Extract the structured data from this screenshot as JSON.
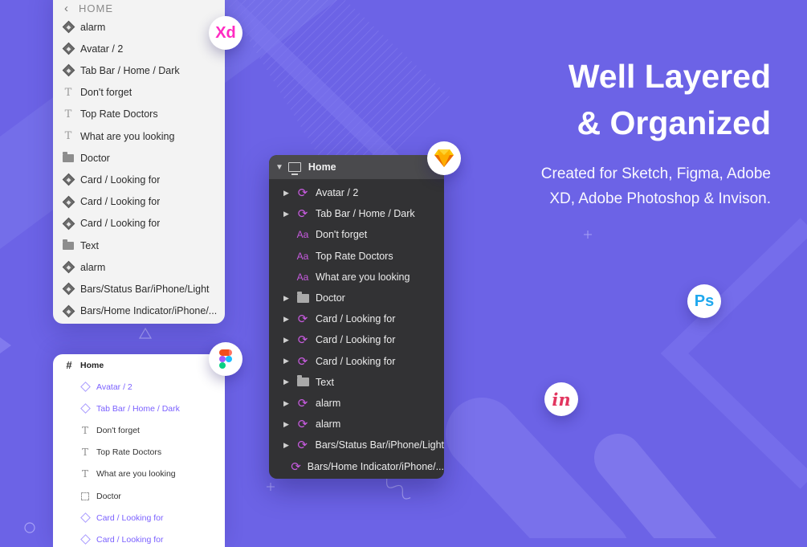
{
  "xd_panel": {
    "header": "HOME",
    "layers": [
      {
        "icon": "symbol-icon",
        "label": "alarm"
      },
      {
        "icon": "symbol-icon",
        "label": "Avatar / 2"
      },
      {
        "icon": "symbol-icon",
        "label": "Tab Bar / Home / Dark"
      },
      {
        "icon": "text-icon",
        "label": "Don't forget"
      },
      {
        "icon": "text-icon",
        "label": "Top Rate Doctors"
      },
      {
        "icon": "text-icon",
        "label": "What are you looking"
      },
      {
        "icon": "folder-icon",
        "label": "Doctor"
      },
      {
        "icon": "symbol-icon",
        "label": "Card / Looking for"
      },
      {
        "icon": "symbol-icon",
        "label": "Card / Looking for"
      },
      {
        "icon": "symbol-icon",
        "label": "Card / Looking for"
      },
      {
        "icon": "folder-icon",
        "label": "Text"
      },
      {
        "icon": "symbol-icon",
        "label": "alarm"
      },
      {
        "icon": "symbol-icon",
        "label": "Bars/Status Bar/iPhone/Light"
      },
      {
        "icon": "symbol-icon",
        "label": "Bars/Home Indicator/iPhone/..."
      }
    ]
  },
  "figma_panel": {
    "header": "Home",
    "layers": [
      {
        "icon": "component-icon",
        "label": "Avatar / 2",
        "purple": true
      },
      {
        "icon": "component-icon",
        "label": "Tab Bar / Home / Dark",
        "purple": true
      },
      {
        "icon": "text-icon",
        "label": "Don't forget",
        "purple": false
      },
      {
        "icon": "text-icon",
        "label": "Top Rate Doctors",
        "purple": false
      },
      {
        "icon": "text-icon",
        "label": "What are you looking",
        "purple": false
      },
      {
        "icon": "group-icon",
        "label": "Doctor",
        "purple": false
      },
      {
        "icon": "component-icon",
        "label": "Card / Looking for",
        "purple": true
      },
      {
        "icon": "component-icon",
        "label": "Card / Looking for",
        "purple": true
      }
    ]
  },
  "sketch_panel": {
    "header": "Home",
    "layers": [
      {
        "icon": "symbol-icon",
        "label": "Avatar / 2",
        "expandable": true
      },
      {
        "icon": "symbol-icon",
        "label": "Tab Bar / Home / Dark",
        "expandable": true
      },
      {
        "icon": "text-icon",
        "label": "Don't forget",
        "expandable": false
      },
      {
        "icon": "text-icon",
        "label": "Top Rate Doctors",
        "expandable": false
      },
      {
        "icon": "text-icon",
        "label": "What are you looking",
        "expandable": false
      },
      {
        "icon": "folder-icon",
        "label": "Doctor",
        "expandable": true
      },
      {
        "icon": "symbol-icon",
        "label": "Card / Looking for",
        "expandable": true
      },
      {
        "icon": "symbol-icon",
        "label": "Card / Looking for",
        "expandable": true
      },
      {
        "icon": "symbol-icon",
        "label": "Card / Looking for",
        "expandable": true
      },
      {
        "icon": "folder-icon",
        "label": "Text",
        "expandable": true
      },
      {
        "icon": "symbol-icon",
        "label": "alarm",
        "expandable": true
      },
      {
        "icon": "symbol-icon",
        "label": "alarm",
        "expandable": true
      },
      {
        "icon": "symbol-icon",
        "label": "Bars/Status Bar/iPhone/Light",
        "expandable": true
      },
      {
        "icon": "symbol-icon",
        "label": "Bars/Home Indicator/iPhone/...",
        "expandable": false
      }
    ]
  },
  "badges": {
    "xd": "Xd",
    "ps": "Ps",
    "invision": "in"
  },
  "headline": {
    "line1": "Well Layered",
    "line2": "& Organized"
  },
  "subline": {
    "line1": "Created for Sketch, Figma, Adobe",
    "line2": "XD, Adobe Photoshop & Invison."
  },
  "colors": {
    "background": "#6c63e6",
    "figma_accent": "#7b61ff",
    "sketch_symbol": "#c85be0",
    "sketch_bg": "#323234",
    "xd_bg": "#f3f3f3"
  }
}
